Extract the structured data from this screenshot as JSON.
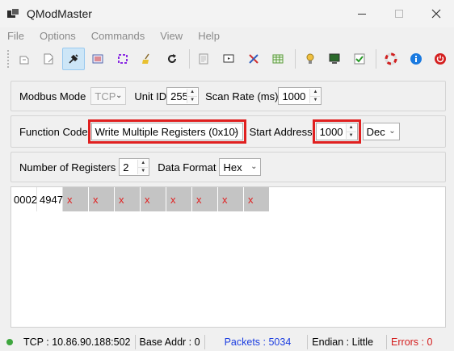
{
  "window": {
    "title": "QModMaster",
    "minimize": "minimize",
    "maximize": "maximize",
    "close": "close"
  },
  "menu": [
    "File",
    "Options",
    "Commands",
    "View",
    "Help"
  ],
  "toolbar": {
    "icons": [
      "connect-icon",
      "disconnect-icon",
      "plug-icon",
      "bus-monitor-icon",
      "scan-icon",
      "clear-icon",
      "refresh-icon",
      "document-icon",
      "screen-icon",
      "tools-icon",
      "table-icon",
      "settings-icon",
      "terminal-icon",
      "checklist-icon",
      "help-icon",
      "info-icon",
      "exit-icon"
    ]
  },
  "mode_panel": {
    "modbus_mode_label": "Modbus Mode",
    "modbus_mode_value": "TCP",
    "unit_id_label": "Unit ID",
    "unit_id_value": "255",
    "scan_rate_label": "Scan Rate (ms)",
    "scan_rate_value": "1000"
  },
  "function_panel": {
    "function_code_label": "Function Code",
    "function_code_value": "Write Multiple Registers (0x10)",
    "start_address_label": "Start Address",
    "start_address_value": "1000",
    "address_format_value": "Dec"
  },
  "registers_panel": {
    "number_label": "Number of Registers",
    "number_value": "2",
    "data_format_label": "Data Format",
    "data_format_value": "Hex"
  },
  "registers": {
    "values": [
      "0002",
      "4947"
    ],
    "empty": [
      "x",
      "x",
      "x",
      "x",
      "x",
      "x",
      "x",
      "x"
    ]
  },
  "status": {
    "connection": "TCP : 10.86.90.188:502",
    "base_addr": "Base Addr : 0",
    "packets": "Packets : 5034",
    "endian": "Endian : Little",
    "errors": "Errors : 0"
  },
  "colors": {
    "highlight": "#e02020",
    "packets": "#1c3ee0",
    "errors": "#d41e1e",
    "led": "#3ea63e"
  }
}
